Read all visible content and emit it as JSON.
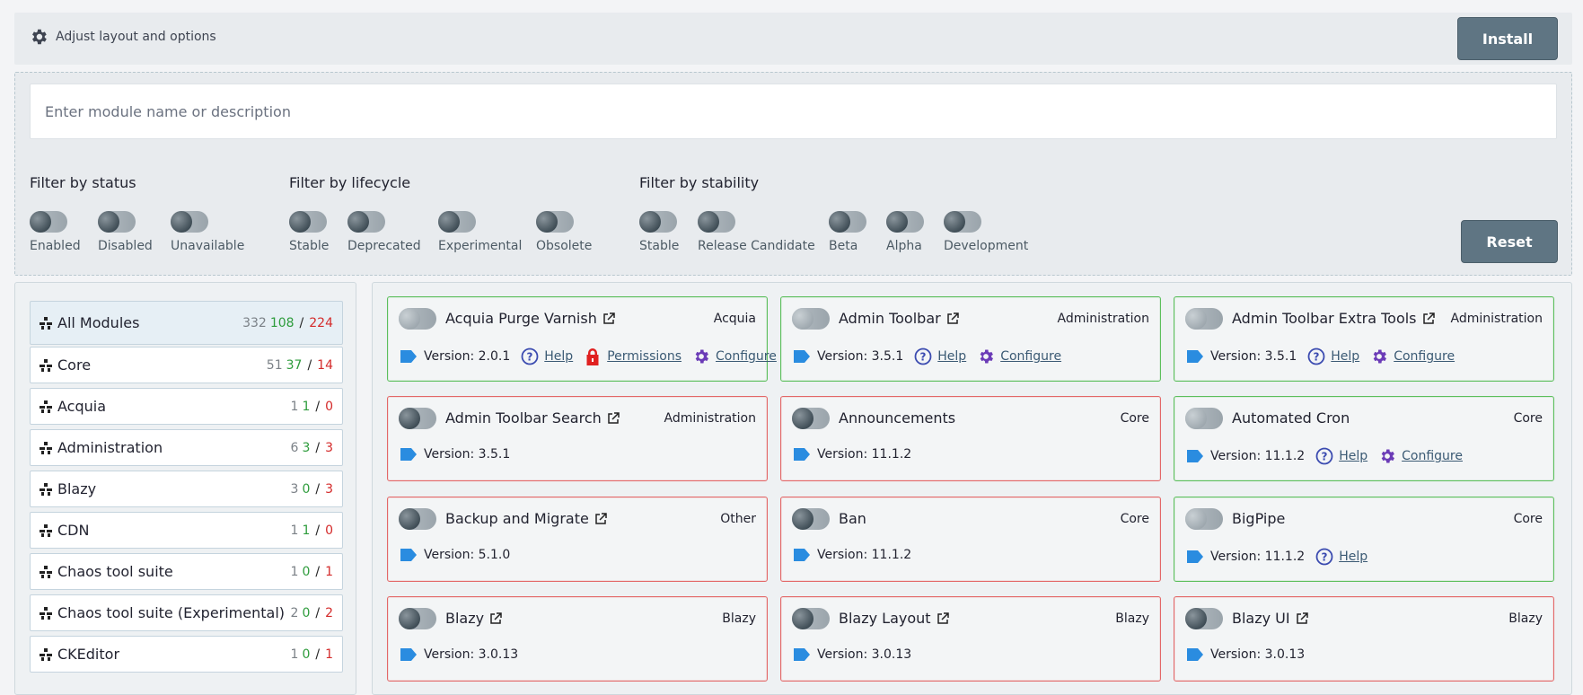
{
  "topbar": {
    "adjust_label": "Adjust layout and options",
    "install_label": "Install"
  },
  "search": {
    "placeholder": "Enter module name or description"
  },
  "filters": {
    "status": {
      "title": "Filter by status",
      "items": [
        "Enabled",
        "Disabled",
        "Unavailable"
      ]
    },
    "lifecycle": {
      "title": "Filter by lifecycle",
      "items": [
        "Stable",
        "Deprecated",
        "Experimental",
        "Obsolete"
      ]
    },
    "stability": {
      "title": "Filter by stability",
      "items": [
        "Stable",
        "Release Candidate",
        "Beta",
        "Alpha",
        "Development"
      ]
    },
    "reset_label": "Reset"
  },
  "categories": [
    {
      "name": "All Modules",
      "total": "332",
      "enabled": "108",
      "disabled": "224",
      "active": true
    },
    {
      "name": "Core",
      "total": "51",
      "enabled": "37",
      "disabled": "14"
    },
    {
      "name": "Acquia",
      "total": "1",
      "enabled": "1",
      "disabled": "0"
    },
    {
      "name": "Administration",
      "total": "6",
      "enabled": "3",
      "disabled": "3"
    },
    {
      "name": "Blazy",
      "total": "3",
      "enabled": "0",
      "disabled": "3"
    },
    {
      "name": "CDN",
      "total": "1",
      "enabled": "1",
      "disabled": "0"
    },
    {
      "name": "Chaos tool suite",
      "total": "1",
      "enabled": "0",
      "disabled": "1"
    },
    {
      "name": "Chaos tool suite (Experimental)",
      "total": "2",
      "enabled": "0",
      "disabled": "2"
    },
    {
      "name": "CKEditor",
      "total": "1",
      "enabled": "0",
      "disabled": "1"
    }
  ],
  "modules": [
    {
      "title": "Acquia Purge Varnish",
      "external": true,
      "package": "Acquia",
      "version": "Version: 2.0.1",
      "status": "green",
      "links": [
        "Help",
        "Permissions",
        "Configure"
      ]
    },
    {
      "title": "Admin Toolbar",
      "external": true,
      "package": "Administration",
      "version": "Version: 3.5.1",
      "status": "green",
      "links": [
        "Help",
        "Configure"
      ]
    },
    {
      "title": "Admin Toolbar Extra Tools",
      "external": true,
      "package": "Administration",
      "version": "Version: 3.5.1",
      "status": "green",
      "links": [
        "Help",
        "Configure"
      ]
    },
    {
      "title": "Admin Toolbar Search",
      "external": true,
      "package": "Administration",
      "version": "Version: 3.5.1",
      "status": "red",
      "links": []
    },
    {
      "title": "Announcements",
      "external": false,
      "package": "Core",
      "version": "Version: 11.1.2",
      "status": "red",
      "links": []
    },
    {
      "title": "Automated Cron",
      "external": false,
      "package": "Core",
      "version": "Version: 11.1.2",
      "status": "green",
      "links": [
        "Help",
        "Configure"
      ]
    },
    {
      "title": "Backup and Migrate",
      "external": true,
      "package": "Other",
      "version": "Version: 5.1.0",
      "status": "red",
      "links": []
    },
    {
      "title": "Ban",
      "external": false,
      "package": "Core",
      "version": "Version: 11.1.2",
      "status": "red",
      "links": []
    },
    {
      "title": "BigPipe",
      "external": false,
      "package": "Core",
      "version": "Version: 11.1.2",
      "status": "green",
      "links": [
        "Help"
      ]
    },
    {
      "title": "Blazy",
      "external": true,
      "package": "Blazy",
      "version": "Version: 3.0.13",
      "status": "red",
      "links": []
    },
    {
      "title": "Blazy Layout",
      "external": true,
      "package": "Blazy",
      "version": "Version: 3.0.13",
      "status": "red",
      "links": []
    },
    {
      "title": "Blazy UI",
      "external": true,
      "package": "Blazy",
      "version": "Version: 3.0.13",
      "status": "red",
      "links": []
    }
  ],
  "colors": {
    "accent": "#5f7583",
    "enabled": "#2e9c3c",
    "disabled": "#d42b2b",
    "link_icon": "#3b4bb0",
    "gear_purple": "#6b3bb7",
    "lock_red": "#e02020",
    "tag_blue": "#2a8ce0"
  },
  "icons": {
    "adjust": "gear-icon",
    "category": "modules-icon",
    "external": "external-link-icon",
    "version": "tag-icon",
    "Help": "help-icon",
    "Permissions": "lock-icon",
    "Configure": "gear-icon"
  }
}
